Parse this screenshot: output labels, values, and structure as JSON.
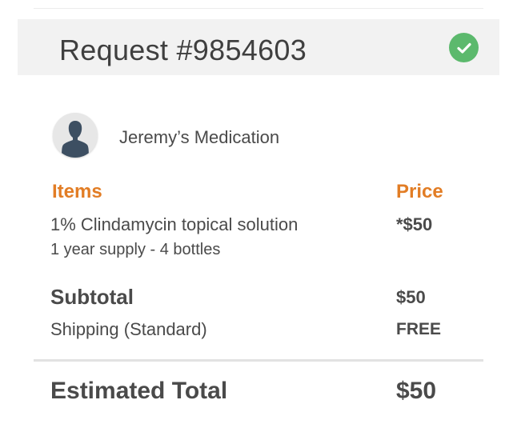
{
  "request": {
    "title": "Request #9854603",
    "status_icon": "check-circle-icon",
    "status_color": "#5cb96d"
  },
  "patient": {
    "avatar_icon": "user-silhouette-icon",
    "name": "Jeremy’s Medication"
  },
  "table": {
    "items_header": "Items",
    "price_header": "Price",
    "header_color": "#e27d25"
  },
  "item": {
    "name": "1% Clindamycin topical solution",
    "detail": "1 year supply - 4 bottles",
    "price": "*$50"
  },
  "summary": {
    "subtotal_label": "Subtotal",
    "subtotal_value": "$50",
    "shipping_label": "Shipping (Standard)",
    "shipping_value": "FREE",
    "total_label": "Estimated Total",
    "total_value": "$50"
  }
}
